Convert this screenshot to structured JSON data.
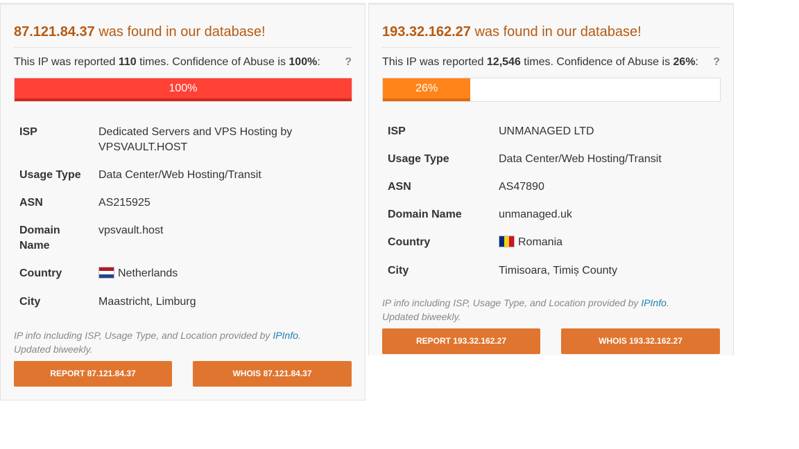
{
  "cards": [
    {
      "ip": "87.121.84.37",
      "found_suffix": "was found in our database!",
      "report_prefix": "This IP was reported",
      "report_count": "110",
      "report_mid": "times. Confidence of Abuse is",
      "confidence": "100%",
      "confidence_value": 100,
      "report_end": ":",
      "help": "?",
      "bar_label": "100%",
      "bar_color": "#ff4136",
      "rows": {
        "isp_label": "ISP",
        "isp_value": "Dedicated Servers and VPS Hosting by VPSVAULT.HOST",
        "usage_label": "Usage Type",
        "usage_value": "Data Center/Web Hosting/Transit",
        "asn_label": "ASN",
        "asn_value": "AS215925",
        "domain_label": "Domain Name",
        "domain_value": "vpsvault.host",
        "country_label": "Country",
        "country_value": "Netherlands",
        "country_flag": "flag-netherlands",
        "city_label": "City",
        "city_value": "Maastricht, Limburg"
      },
      "footnote_pre": "IP info including ISP, Usage Type, and Location provided by",
      "footnote_link": "IPInfo",
      "footnote_post": ". Updated biweekly.",
      "report_button": "REPORT 87.121.84.37",
      "whois_button": "WHOIS 87.121.84.37"
    },
    {
      "ip": "193.32.162.27",
      "found_suffix": "was found in our database!",
      "report_prefix": "This IP was reported",
      "report_count": "12,546",
      "report_mid": "times. Confidence of Abuse is",
      "confidence": "26%",
      "confidence_value": 26,
      "report_end": ":",
      "help": "?",
      "bar_label": "26%",
      "bar_color": "#ff851b",
      "rows": {
        "isp_label": "ISP",
        "isp_value": "UNMANAGED LTD",
        "usage_label": "Usage Type",
        "usage_value": "Data Center/Web Hosting/Transit",
        "asn_label": "ASN",
        "asn_value": "AS47890",
        "domain_label": "Domain Name",
        "domain_value": "unmanaged.uk",
        "country_label": "Country",
        "country_value": "Romania",
        "country_flag": "flag-romania",
        "city_label": "City",
        "city_value": "Timisoara, Timiș County"
      },
      "footnote_pre": "IP info including ISP, Usage Type, and Location provided by",
      "footnote_link": "IPInfo",
      "footnote_post": ". Updated biweekly.",
      "report_button": "REPORT 193.32.162.27",
      "whois_button": "WHOIS 193.32.162.27"
    }
  ],
  "colors": {
    "accent": "#e07530",
    "title": "#b65a12",
    "link": "#1b7fb0"
  }
}
